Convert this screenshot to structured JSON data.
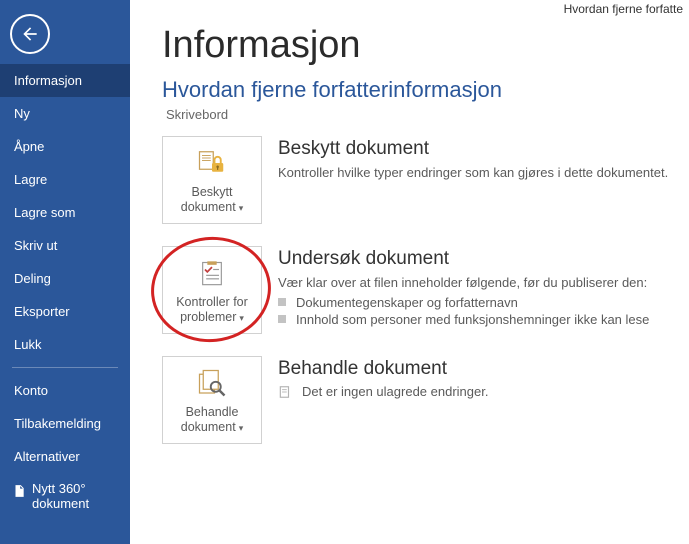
{
  "titlebar": "Hvordan fjerne forfatte",
  "sidebar": {
    "items": [
      "Informasjon",
      "Ny",
      "Åpne",
      "Lagre",
      "Lagre som",
      "Skriv ut",
      "Deling",
      "Eksporter",
      "Lukk"
    ],
    "lower": [
      "Konto",
      "Tilbakemelding",
      "Alternativer"
    ],
    "nytt360": "Nytt 360° dokument"
  },
  "main": {
    "heading": "Informasjon",
    "subheading": "Hvordan fjerne forfatterinformasjon",
    "location": "Skrivebord"
  },
  "protect": {
    "tile": "Beskytt dokument",
    "title": "Beskytt dokument",
    "desc": "Kontroller hvilke typer endringer som kan gjøres i dette dokumentet."
  },
  "inspect": {
    "tile": "Kontroller for problemer",
    "title": "Undersøk dokument",
    "desc": "Vær klar over at filen inneholder følgende, før du publiserer den:",
    "b1": "Dokumentegenskaper og forfatternavn",
    "b2": "Innhold som personer med funksjonshemninger ikke kan lese"
  },
  "manage": {
    "tile": "Behandle dokument",
    "title": "Behandle dokument",
    "desc": "Det er ingen ulagrede endringer."
  }
}
